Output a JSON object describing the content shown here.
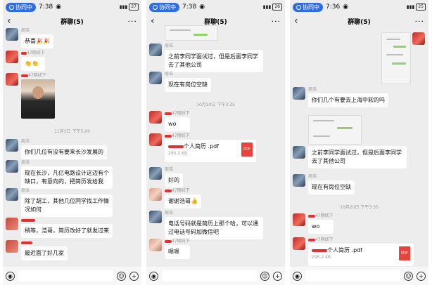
{
  "panels": [
    {
      "status": {
        "pill": "协同中",
        "time": "7:38",
        "battery": "27"
      },
      "chat_title": "群聊(5)",
      "messages": [
        {
          "name": "周浩",
          "text": "恭喜🎉🎉"
        },
        {
          "name": "47期线下",
          "text": "👏👏"
        },
        {
          "name": "47期线下",
          "photo": true
        },
        {
          "timestamp": "11月3日 下午5:00"
        },
        {
          "name": "周浩",
          "text": "你们几位有没有要来长沙发展的"
        },
        {
          "name": "周浩",
          "text": "现在长沙，凡亿电路设计这边有个缺口，有意向的，把简历发给我"
        },
        {
          "name": "周浩",
          "text": "除了胡工，其他几位同学找工作情况如何"
        },
        {
          "name": "",
          "text": "稍等，浩哥，简历改好了就发过来"
        },
        {
          "name": "",
          "text": "最近面了好几家"
        }
      ]
    },
    {
      "status": {
        "pill": "协同中",
        "time": "7:38",
        "battery": "26"
      },
      "chat_title": "群聊(5)",
      "messages": [
        {
          "name": "周浩",
          "text": "之前李同学面试过，但是后面李同学去了其他公司"
        },
        {
          "name": "周浩",
          "text": "现在有岗位空缺"
        },
        {
          "timestamp": "10月20日 下午3:35"
        },
        {
          "name": "47期线下",
          "text": "wo"
        },
        {
          "name": "47期线下",
          "file_name": "个人简历 .pdf",
          "file_size": "295.2 KB",
          "file_icon": "PDF"
        },
        {
          "name": "周浩",
          "text": "好的"
        },
        {
          "name": "47期线下",
          "text": "谢谢浩哥👍"
        },
        {
          "name": "周浩",
          "text": "电话号码就是简历上那个哈，可以通过电话号码加微信吧"
        },
        {
          "name": "47期线下",
          "text": "嗯嗯"
        }
      ]
    },
    {
      "status": {
        "pill": "协同中",
        "time": "7:36",
        "battery": "25"
      },
      "chat_title": "群聊(5)",
      "messages": [
        {
          "name": "周浩",
          "text": "你们几个有要去上海中软的吗"
        },
        {
          "name": "周浩",
          "text": "之前李同学面试过，但是后面李同学去了其他公司"
        },
        {
          "name": "周浩",
          "text": "现在有岗位空缺"
        },
        {
          "timestamp": "10月20日 下午3:35"
        },
        {
          "name": "47期线下",
          "text": "wo"
        },
        {
          "name": "47期线下",
          "file_name": "个人简历 .pdf",
          "file_size": "295.2 KB",
          "file_icon": "PDF"
        }
      ]
    }
  ],
  "input_bar": {
    "emoji_icon": "☺",
    "add_icon": "+",
    "voice_icon": "◉"
  },
  "colors": {
    "pill": "#2f6de1",
    "background": "#ededed",
    "redaction": "#e03030"
  }
}
